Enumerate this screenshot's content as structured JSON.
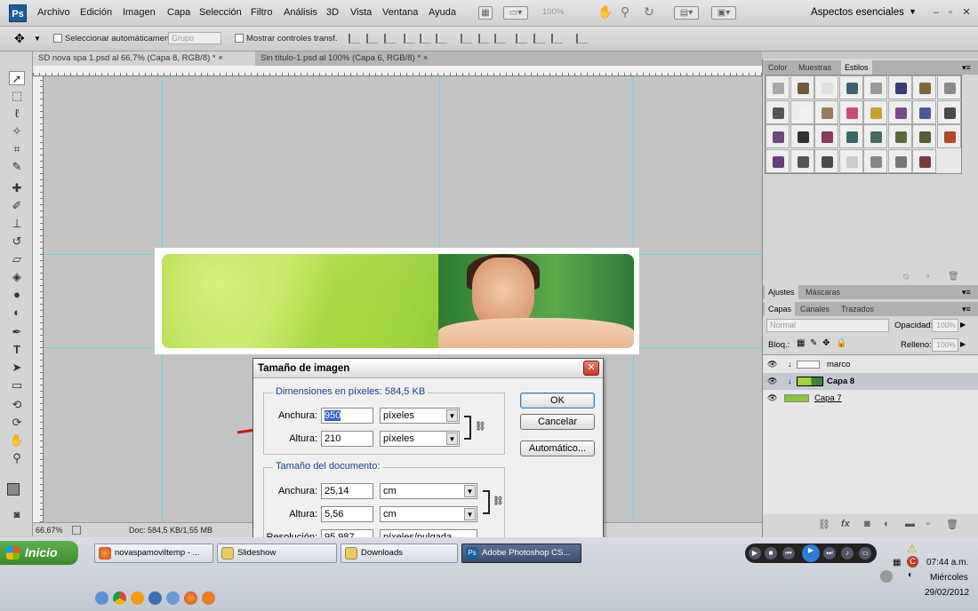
{
  "app": {
    "logo": "Ps",
    "menus": [
      "Archivo",
      "Edición",
      "Imagen",
      "Capa",
      "Selección",
      "Filtro",
      "Análisis",
      "3D",
      "Vista",
      "Ventana",
      "Ayuda"
    ],
    "zoom": "100%",
    "workspace": "Aspectos esenciales",
    "win_min": "–",
    "win_max": "▫",
    "win_close": "✕"
  },
  "options": {
    "auto_select": "Seleccionar automáticamente:",
    "group_value": "Grupo",
    "show_transform": "Mostrar controles transf."
  },
  "tabs": [
    "SD nova spa 1.psd al 66,7% (Capa 8, RGB/8) *",
    "Sin título-1.psd al 100% (Capa 6, RGB/8) *"
  ],
  "tab_close": "×",
  "status": {
    "zoom": "66,67%",
    "doc": "Doc: 584,5 KB/1,55 MB"
  },
  "panels": {
    "top_tabs": [
      "Color",
      "Muestras",
      "Estilos"
    ],
    "adj_tabs": [
      "Ajustes",
      "Máscaras"
    ],
    "layer_tabs": [
      "Capas",
      "Canales",
      "Trazados"
    ],
    "blend": "Normal",
    "opacity_label": "Opacidad:",
    "opacity": "100%",
    "lock_label": "Bloq.:",
    "fill_label": "Relleno:",
    "fill": "100%",
    "layers": [
      {
        "name": "marco"
      },
      {
        "name": "Capa 8"
      },
      {
        "name": "Capa 7"
      }
    ]
  },
  "styles_colors": [
    "#a8a8a8",
    "#6e5a3a",
    "#e0e0e0",
    "#3e6470",
    "#9a9a9a",
    "#3a3a7a",
    "#7a6a3a",
    "#8a8a8a",
    "#555555",
    "#f0f0f0",
    "#9a7a5a",
    "#d04a78",
    "#c8a030",
    "#7a4a8a",
    "#4a5a9a",
    "#4a4a4a",
    "#6a4a7a",
    "#333333",
    "#8a3a5a",
    "#3a6a6a",
    "#4a6a5a",
    "#5a6a3a",
    "#5a5a3a",
    "#b04a2a",
    "#6a3a7a",
    "#555555",
    "#4a4a4a",
    "#cccccc",
    "#888888",
    "#777777",
    "#7a3a3a"
  ],
  "dialog": {
    "title": "Tamaño de imagen",
    "close": "✕",
    "pixel_dims": "Dimensiones en píxeles: 584,5 KB",
    "width_label": "Anchura:",
    "width_value": "950",
    "width_unit": "píxeles",
    "height_label": "Altura:",
    "height_value": "210",
    "height_unit": "píxeles",
    "doc_size": "Tamaño del documento:",
    "doc_width_label": "Anchura:",
    "doc_width_value": "25,14",
    "doc_width_unit": "cm",
    "doc_height_label": "Altura:",
    "doc_height_value": "5,56",
    "doc_height_unit": "cm",
    "res_label": "Resolución:",
    "res_value": "95,987",
    "res_unit": "píxeles/pulgada",
    "ok": "OK",
    "cancel": "Cancelar",
    "auto": "Automático..."
  },
  "taskbar": {
    "start": "Inicio",
    "tasks": [
      "novaspamoviltemp - ...",
      "Slideshow",
      "Downloads",
      "Adobe Photoshop CS..."
    ],
    "time": "07:44 a.m.",
    "day": "Miércoles",
    "date": "29/02/2012"
  }
}
